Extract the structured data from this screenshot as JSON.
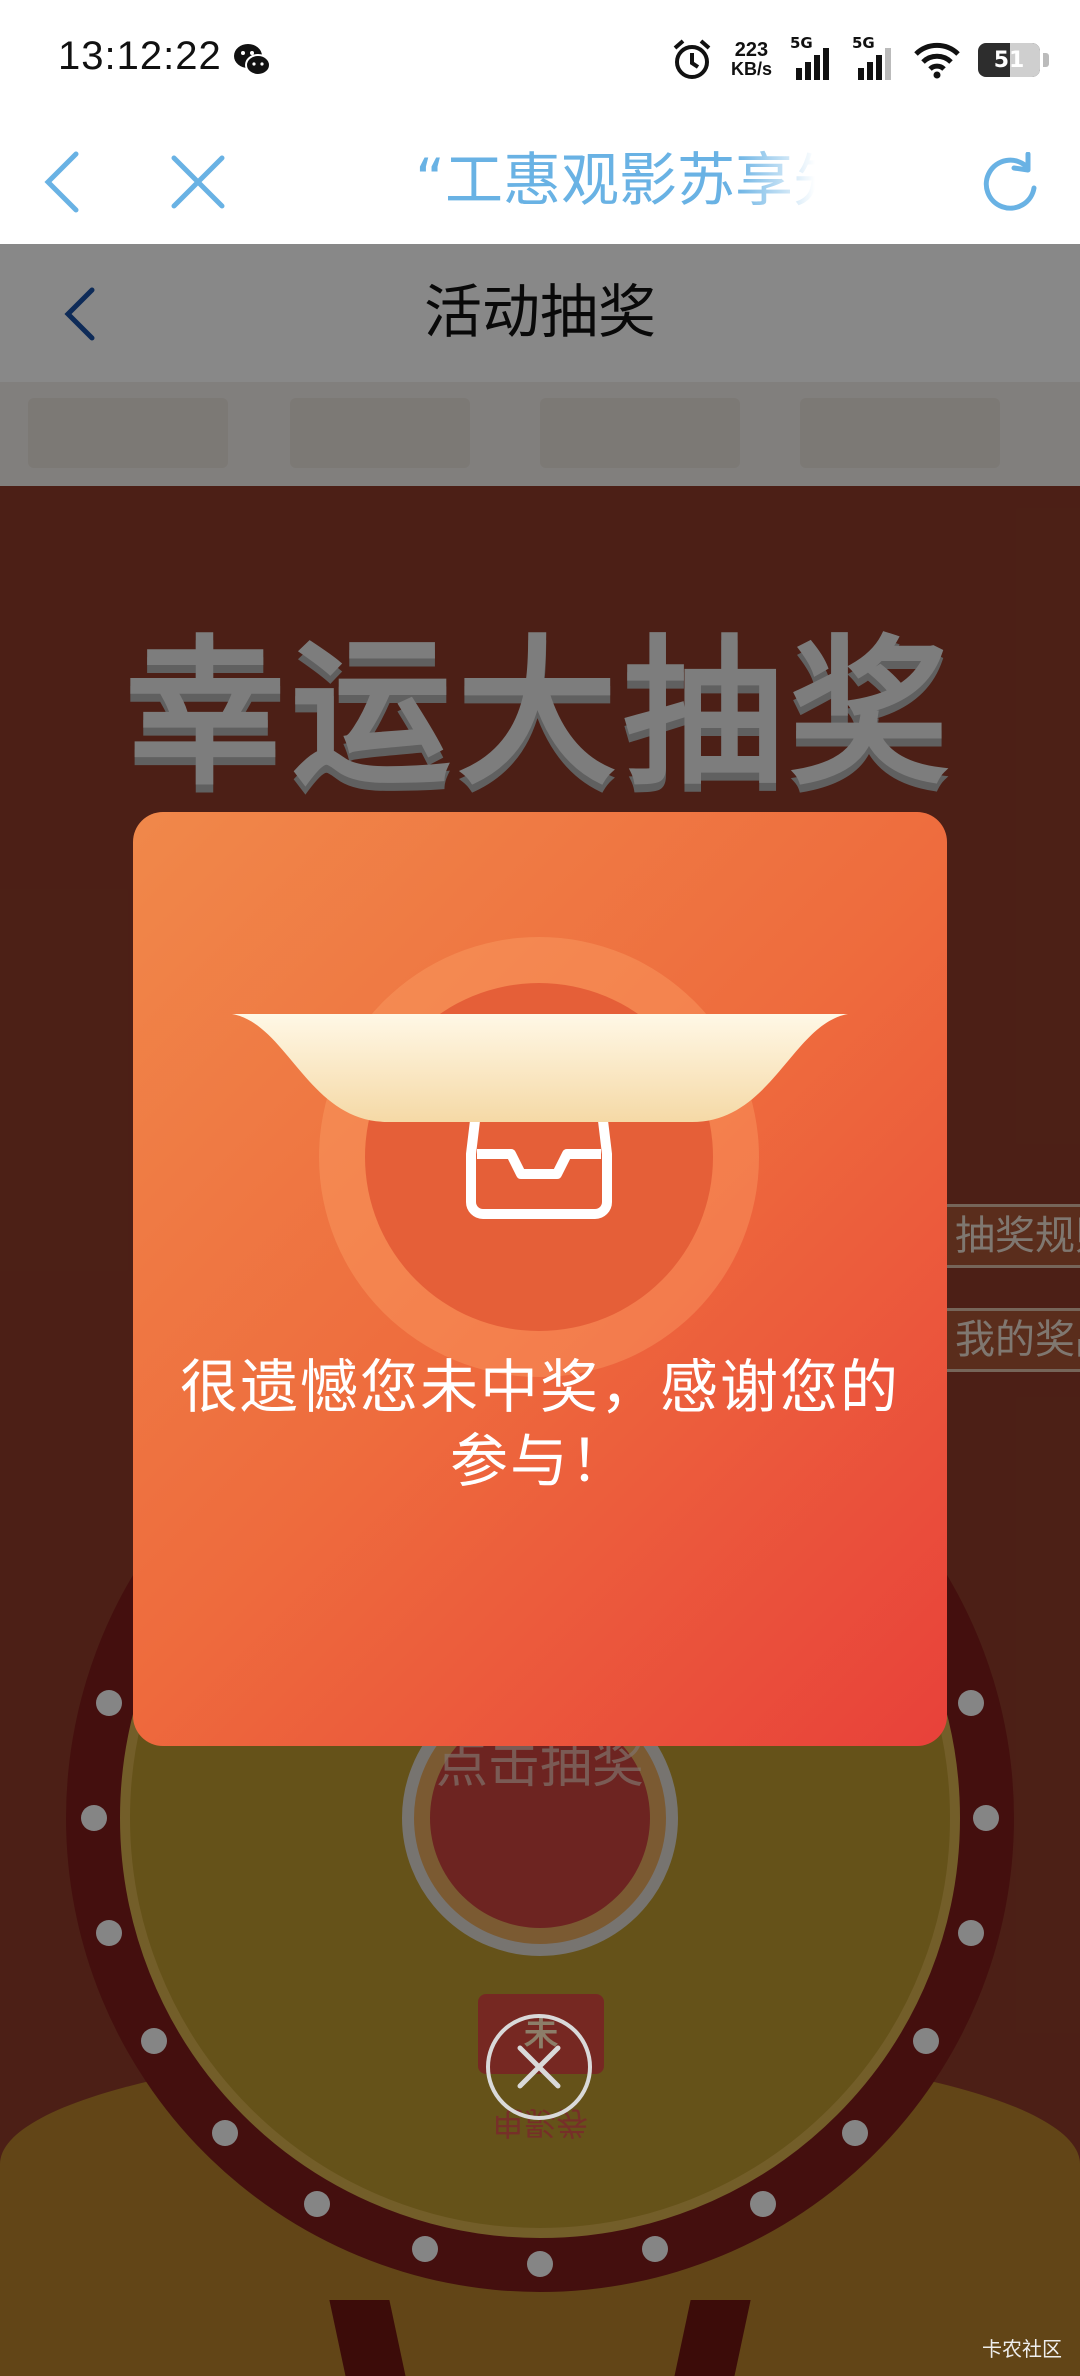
{
  "status_bar": {
    "time": "13:12:22",
    "net_speed_value": "223",
    "net_speed_unit": "KB/s",
    "sim1_label": "5G",
    "sim2_label": "5G",
    "battery": "51",
    "icons": [
      "wechat-icon",
      "alarm-icon",
      "signal-icon",
      "wifi-icon",
      "battery-icon"
    ]
  },
  "browser_nav": {
    "title": "“工惠观影苏享先",
    "icons": [
      "back-icon",
      "close-icon",
      "refresh-icon"
    ],
    "accent": "#69b2e4"
  },
  "page": {
    "title": "活动抽奖",
    "banner": "幸运大抽奖",
    "side_buttons": [
      "抽奖规则",
      "我的奖品"
    ],
    "wheel_center": "点击抽奖",
    "prize_label": "未",
    "prize_text": "电影券"
  },
  "modal": {
    "message": "很遗憾您未中奖，感谢您的参与！",
    "icon": "empty-tray-icon"
  },
  "watermark": "卡农社区",
  "colors": {
    "modal_start": "#f0884a",
    "modal_end": "#e8413a",
    "page_bg": "#8b3a28"
  }
}
